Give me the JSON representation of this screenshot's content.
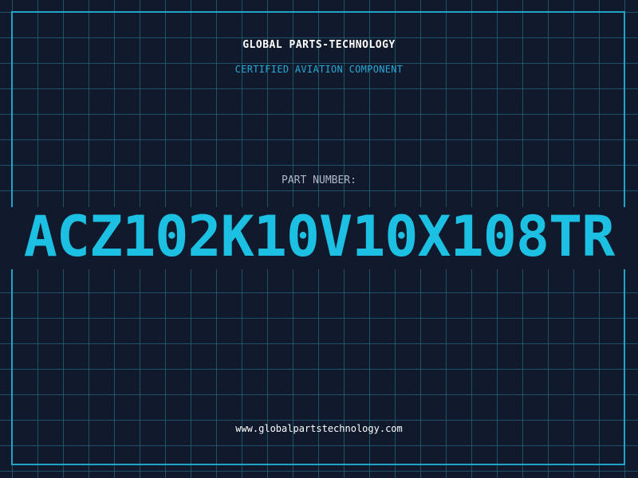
{
  "header": {
    "company": "GLOBAL PARTS-TECHNOLOGY",
    "subtitle": "CERTIFIED AVIATION COMPONENT"
  },
  "part": {
    "label": "PART NUMBER:",
    "number": "ACZ102K10V10X108TR"
  },
  "footer": {
    "url": "www.globalpartstechnology.com"
  },
  "colors": {
    "background": "#101a2c",
    "grid": "#307e94",
    "accent": "#1cc0e2",
    "frame": "#1fa4c7"
  }
}
